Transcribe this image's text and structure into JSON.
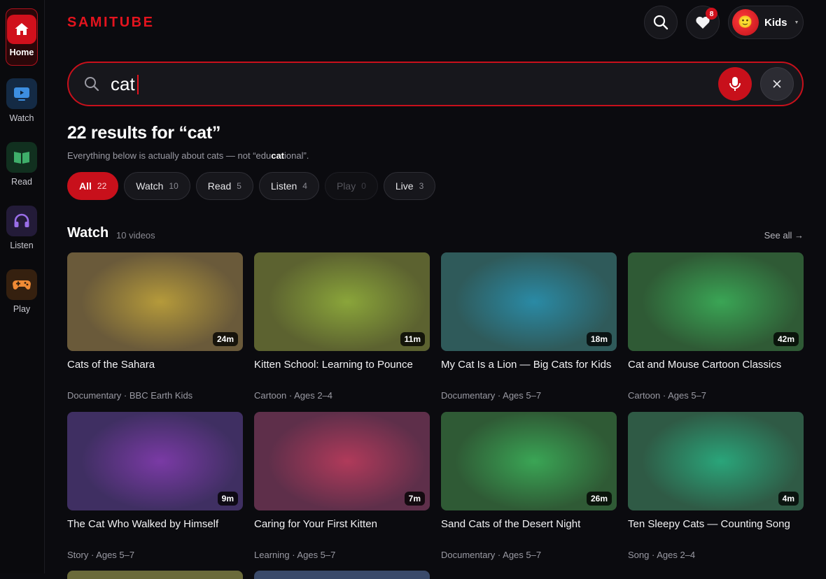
{
  "app": {
    "logo": "SAMITUBE"
  },
  "sidebar": {
    "items": [
      {
        "label": "Home",
        "icon": "home-icon",
        "color": "#d0101c"
      },
      {
        "label": "Watch",
        "icon": "tv-icon",
        "color": "#1f3a5f"
      },
      {
        "label": "Read",
        "icon": "book-icon",
        "color": "#143a2a"
      },
      {
        "label": "Listen",
        "icon": "headphones-icon",
        "color": "#2a2140"
      },
      {
        "label": "Play",
        "icon": "gamepad-icon",
        "color": "#3a2414"
      }
    ]
  },
  "header": {
    "favorites_count": "8",
    "profile_name": "Kids"
  },
  "search": {
    "query": "cat",
    "placeholder": ""
  },
  "results": {
    "title": "22 results for “cat”",
    "sub_before": "Everything below is actually about cats — not “edu",
    "sub_bold": "cat",
    "sub_after": "ional”."
  },
  "filters": [
    {
      "label": "All",
      "count": "22",
      "state": "active"
    },
    {
      "label": "Watch",
      "count": "10",
      "state": "normal"
    },
    {
      "label": "Read",
      "count": "5",
      "state": "normal"
    },
    {
      "label": "Listen",
      "count": "4",
      "state": "normal"
    },
    {
      "label": "Play",
      "count": "0",
      "state": "disabled"
    },
    {
      "label": "Live",
      "count": "3",
      "state": "normal"
    }
  ],
  "watch_section": {
    "title": "Watch",
    "count": "10 videos",
    "see_all": "See all →",
    "videos": [
      {
        "title": "Cats of the Sahara",
        "duration": "24m",
        "meta": "Documentary · BBC Earth Kids",
        "bg": "#6a5a3a",
        "glow": "#b59a3a"
      },
      {
        "title": "Kitten School: Learning to Pounce",
        "duration": "11m",
        "meta": "Cartoon · Ages 2–4",
        "bg": "#5c6230",
        "glow": "#8aa53a"
      },
      {
        "title": "My Cat Is a Lion — Big Cats for Kids",
        "duration": "18m",
        "meta": "Documentary · Ages 5–7",
        "bg": "#2f5a5a",
        "glow": "#2a8aa5"
      },
      {
        "title": "Cat and Mouse Cartoon Classics",
        "duration": "42m",
        "meta": "Cartoon · Ages 5–7",
        "bg": "#2f5a35",
        "glow": "#3aa555"
      },
      {
        "title": "The Cat Who Walked by Himself",
        "duration": "9m",
        "meta": "Story · Ages 5–7",
        "bg": "#3f2f62",
        "glow": "#7a3aa5"
      },
      {
        "title": "Caring for Your First Kitten",
        "duration": "7m",
        "meta": "Learning · Ages 5–7",
        "bg": "#5e2f4a",
        "glow": "#b03a5a"
      },
      {
        "title": "Sand Cats of the Desert Night",
        "duration": "26m",
        "meta": "Documentary · Ages 5–7",
        "bg": "#2f5a35",
        "glow": "#3aa555"
      },
      {
        "title": "Ten Sleepy Cats — Counting Song",
        "duration": "4m",
        "meta": "Song · Ages 2–4",
        "bg": "#2f5a45",
        "glow": "#2aa57a"
      }
    ]
  }
}
